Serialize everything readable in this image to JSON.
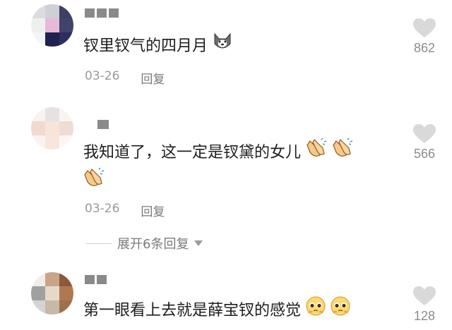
{
  "comments": [
    {
      "text": "钗里钗气的四月月",
      "date": "03-26",
      "reply_label": "回复",
      "likes": "862",
      "emojis": [
        "husky-dog-face"
      ]
    },
    {
      "text": "我知道了，这一定是钗黛的女儿",
      "date": "03-26",
      "reply_label": "回复",
      "likes": "566",
      "emojis": [
        "clapping-hands",
        "clapping-hands",
        "clapping-hands"
      ]
    },
    {
      "text": "第一眼看上去就是薛宝钗的感觉",
      "likes": "128",
      "emojis": [
        "pleading-face",
        "pleading-face"
      ]
    }
  ],
  "expand_replies": {
    "label": "展开6条回复",
    "icon": "caret-down"
  },
  "colors": {
    "text": "#1d1d1d",
    "meta": "#9a9a9a",
    "like_icon": "#d9d9d9"
  }
}
